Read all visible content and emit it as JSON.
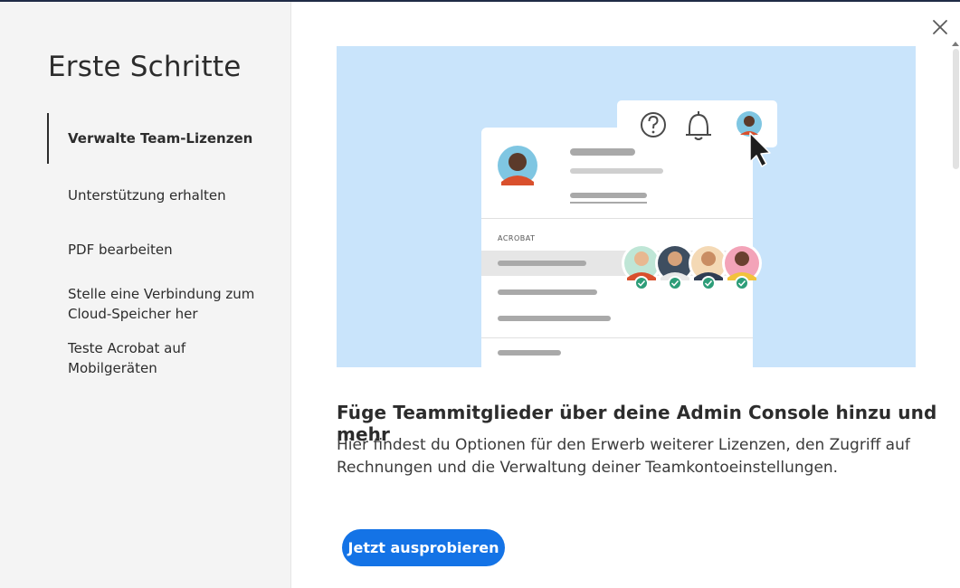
{
  "sidebar": {
    "title": "Erste Schritte",
    "items": [
      {
        "label": "Verwalte Team-Lizenzen",
        "active": true
      },
      {
        "label": "Unterstützung erhalten"
      },
      {
        "label": "PDF bearbeiten"
      },
      {
        "label": "Stelle eine Verbindung zum Cloud-Speicher her"
      },
      {
        "label": "Teste Acrobat auf Mobilgeräten"
      }
    ]
  },
  "main": {
    "illustration": {
      "section_label": "ACROBAT"
    },
    "headline": "Füge Teammitglieder über deine Admin Console hinzu und mehr",
    "description": "Hier findest du Optionen für den Erwerb weiterer Lizenzen, den Zugriff auf Rechnungen und die Verwaltung deiner Teamkontoeinstellungen.",
    "cta_label": "Jetzt ausprobieren"
  },
  "colors": {
    "accent": "#1473e6",
    "illustration_bg": "#c9e4fb",
    "sidebar_bg": "#f4f4f4"
  }
}
